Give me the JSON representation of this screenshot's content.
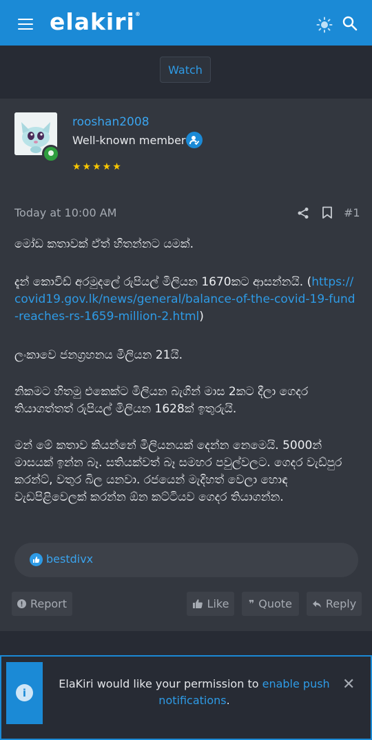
{
  "header": {
    "logo": "elakiri",
    "trademark": "®",
    "icons": [
      "menu-icon",
      "theme-sun-icon",
      "search-icon"
    ],
    "brand_color": "#1b8ad6"
  },
  "watch_label": "Watch",
  "post": {
    "username": "rooshan2008",
    "user_title": "Well-known member",
    "stars": "★★★★★",
    "date": "Today at 10:00 AM",
    "number": "#1",
    "paragraphs": {
      "p1": "මෝඩ කතාවක් ඒත් හිතන්නට යමක්.",
      "p2_text": "දැන් කොවිඩ් අරමුදලේ රුපියල් මිලියන 1670කට ආසන්නයි. (",
      "p2_link": "https://covid19.gov.lk/news/general/balance-of-the-covid-19-fund-reaches-rs-1659-million-2.html",
      "p2_end": ")",
      "p3": "ලංකාවෙ ජනග්‍රහනය මිලියන 21යි.",
      "p4": "නිකමට හිතමු එකෙක්ට මිලියන බැගින් මාස 2කට දීලා ගෙදර තියාගත්තත් රුපියල් මිලියන 1628ක් ඉතුරුයි.",
      "p5": "මන් මේ කතාව කියන්නේ මිලියනයක් දෙන්න නෙමෙයි. 5000න් මාසයක් ඉන්න බෑ. සතියක්වත් බෑ සමහර පවුල්වලට. ගෙදර වැඩ්පුර කරන්ට්, වතුර බිල යනවා. රජයෙන් මැදිහත් වෙලා හොඳ වැඩපිළිවෙලක් කරන්න ඕන කට්ටියව ගෙදර තියාගන්න."
    },
    "reaction_user": "bestdivx",
    "actions": {
      "report": "Report",
      "like": "Like",
      "quote": "Quote",
      "reply": "Reply"
    }
  },
  "notification": {
    "text_before": "ElaKiri would like your permission to ",
    "link_text": "enable push notifications",
    "text_after": ".",
    "close": "✕"
  }
}
